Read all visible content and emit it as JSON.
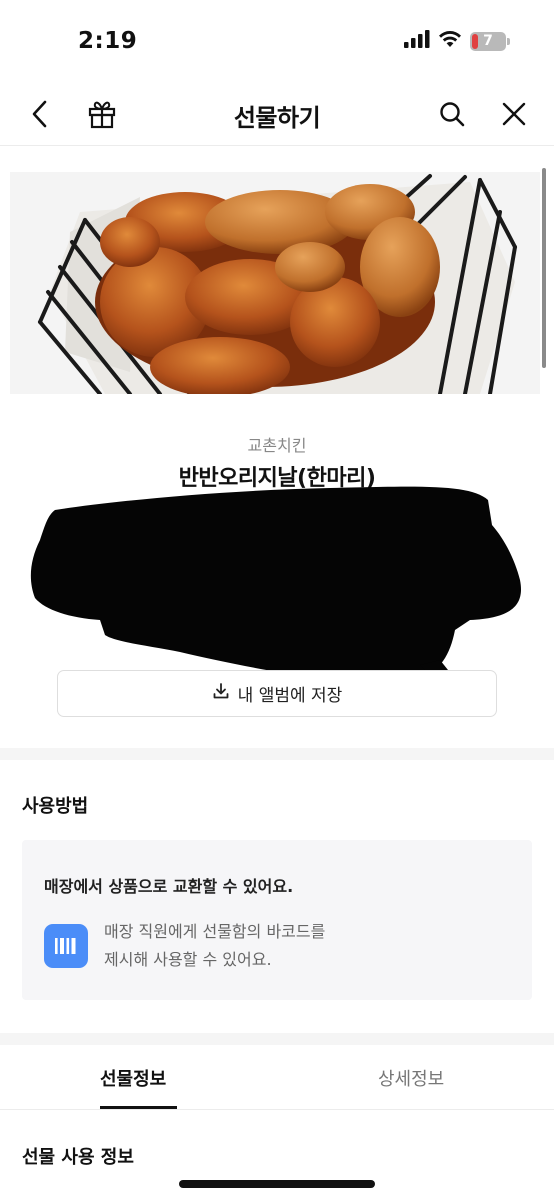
{
  "status_bar": {
    "time": "2:19",
    "battery_level": "7",
    "icons": [
      "cellular-signal-icon",
      "wifi-icon",
      "battery-icon"
    ]
  },
  "nav": {
    "title": "선물하기",
    "icons": [
      "back-arrow-icon",
      "gift-icon",
      "search-icon",
      "close-icon"
    ]
  },
  "product": {
    "brand": "교촌치킨",
    "name": "반반오리지날(한마리)",
    "save_label": "내 앨범에 저장"
  },
  "howto": {
    "title": "사용방법",
    "heading": "매장에서 상품으로 교환할 수 있어요.",
    "line1": "매장 직원에게 선물함의 바코드를",
    "line2": "제시해 사용할 수 있어요."
  },
  "tabs": {
    "active": "선물정보",
    "inactive": "상세정보"
  },
  "gift_info": {
    "title": "선물 사용 정보"
  },
  "colors": {
    "accent_blue": "#4b8df8",
    "battery_low": "#e04040",
    "divider": "#f5f5f5"
  }
}
